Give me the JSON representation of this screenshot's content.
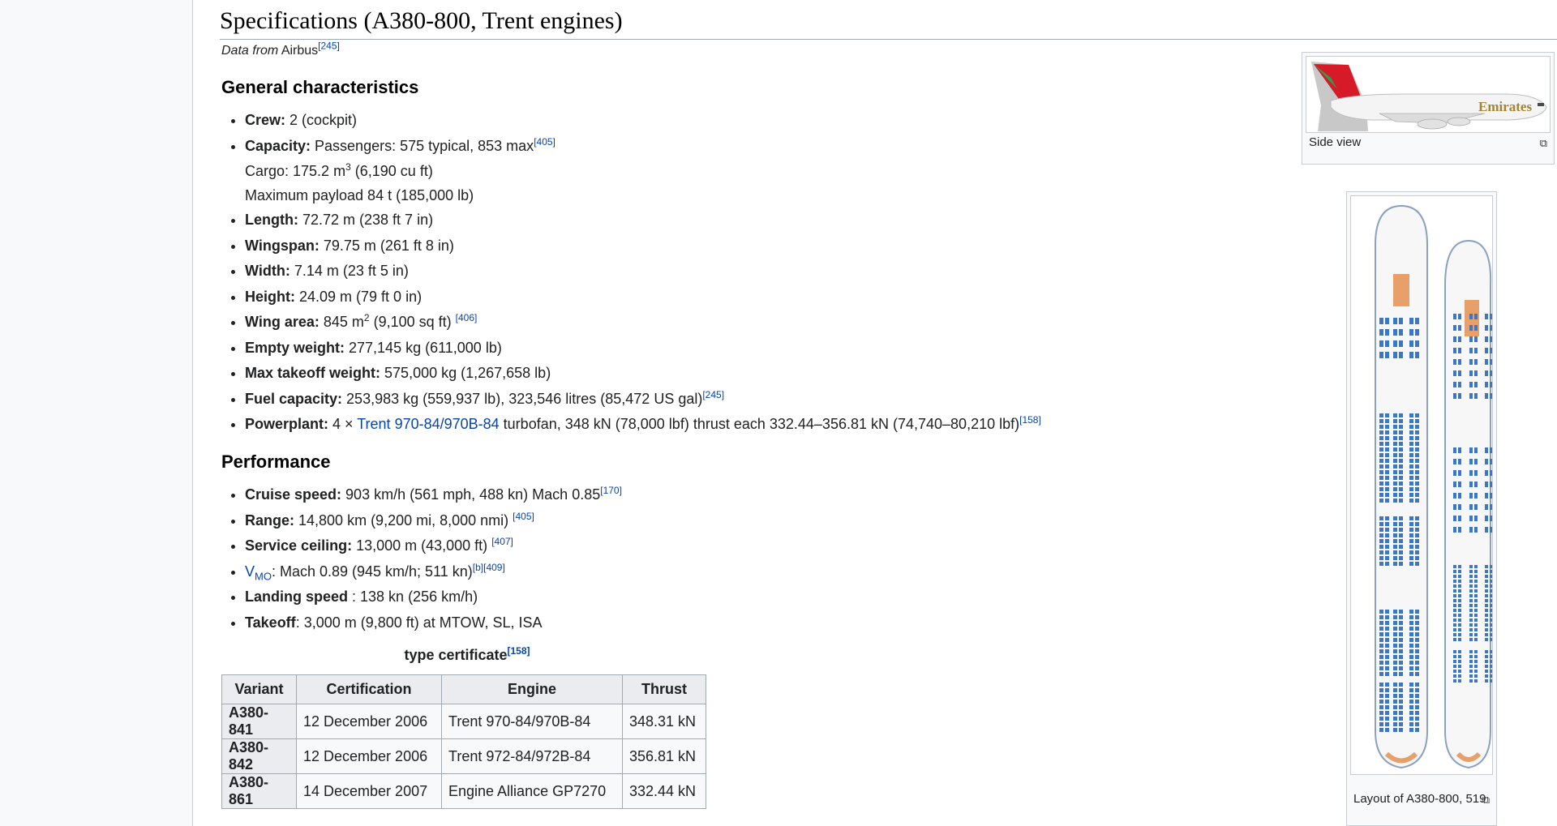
{
  "heading": "Specifications (A380-800, Trent engines)",
  "source_note": {
    "italic": "Data from",
    "text": " Airbus",
    "ref": "[245]"
  },
  "general": {
    "heading": "General characteristics",
    "crew": {
      "label": "Crew:",
      "value": " 2 (cockpit)"
    },
    "capacity": {
      "label": "Capacity:",
      "value": " Passengers: 575 typical, 853 max",
      "ref": "[405]",
      "cargo_pre": "Cargo: 175.2 m",
      "cargo_sup": "3",
      "cargo_post": " (6,190 cu ft)",
      "payload": "Maximum payload 84 t (185,000 lb)"
    },
    "length": {
      "label": "Length:",
      "value": " 72.72 m (238 ft 7 in)"
    },
    "wingspan": {
      "label": "Wingspan:",
      "value": " 79.75 m (261 ft 8 in)"
    },
    "width": {
      "label": "Width:",
      "value": " 7.14 m (23 ft 5 in)"
    },
    "height": {
      "label": "Height:",
      "value": " 24.09 m (79 ft 0 in)"
    },
    "wing_area": {
      "label": "Wing area:",
      "pre": " 845 m",
      "sup": "2",
      "post": " (9,100 sq ft) ",
      "ref": "[406]"
    },
    "empty_weight": {
      "label": "Empty weight:",
      "value": " 277,145 kg (611,000 lb)"
    },
    "mtow": {
      "label": "Max takeoff weight:",
      "value": " 575,000 kg (1,267,658 lb)"
    },
    "fuel": {
      "label": "Fuel capacity:",
      "value": " 253,983 kg (559,937 lb), 323,546 litres (85,472 US gal)",
      "ref": "[245]"
    },
    "powerplant": {
      "label": "Powerplant:",
      "pre": " 4 × ",
      "link": "Trent 970-84/970B-84",
      "post": " turbofan, 348 kN (78,000 lbf) thrust each 332.44–356.81 kN (74,740–80,210 lbf)",
      "ref": "[158]"
    }
  },
  "performance": {
    "heading": "Performance",
    "cruise": {
      "label": "Cruise speed:",
      "value": " 903 km/h (561 mph, 488 kn) Mach 0.85",
      "ref": "[170]"
    },
    "range": {
      "label": "Range:",
      "value": " 14,800 km (9,200 mi, 8,000 nmi) ",
      "ref": "[405]"
    },
    "ceiling": {
      "label": "Service ceiling:",
      "value": " 13,000 m (43,000 ft) ",
      "ref": "[407]"
    },
    "vmo": {
      "link_main": "V",
      "link_sub": "MO",
      "value": ": Mach 0.89 (945 km/h; 511 kn)",
      "ref": "[b][409]"
    },
    "landing": {
      "label": "Landing speed",
      "value": " : 138 kn (256 km/h)"
    },
    "takeoff": {
      "label": "Takeoff",
      "value": ": 3,000 m (9,800 ft) at MTOW, SL, ISA"
    }
  },
  "table": {
    "caption": "type certificate",
    "caption_ref": "[158]",
    "headers": [
      "Variant",
      "Certification",
      "Engine",
      "Thrust"
    ],
    "rows": [
      [
        "A380-841",
        "12 December 2006",
        "Trent 970-84/970B-84",
        "348.31 kN"
      ],
      [
        "A380-842",
        "12 December 2006",
        "Trent 972-84/972B-84",
        "356.81 kN"
      ],
      [
        "A380-861",
        "14 December 2007",
        "Engine Alliance GP7270",
        "332.44 kN"
      ]
    ]
  },
  "images": {
    "side_view_caption": "Side view",
    "airline_livery": "Emirates",
    "layout_caption": "Layout of A380-800, 519",
    "enlarge_icon": "enlarge-icon"
  },
  "colors": {
    "link": "#0645ad",
    "seat_blue": "#3a77c7",
    "stairs_orange": "#e8a06a"
  }
}
